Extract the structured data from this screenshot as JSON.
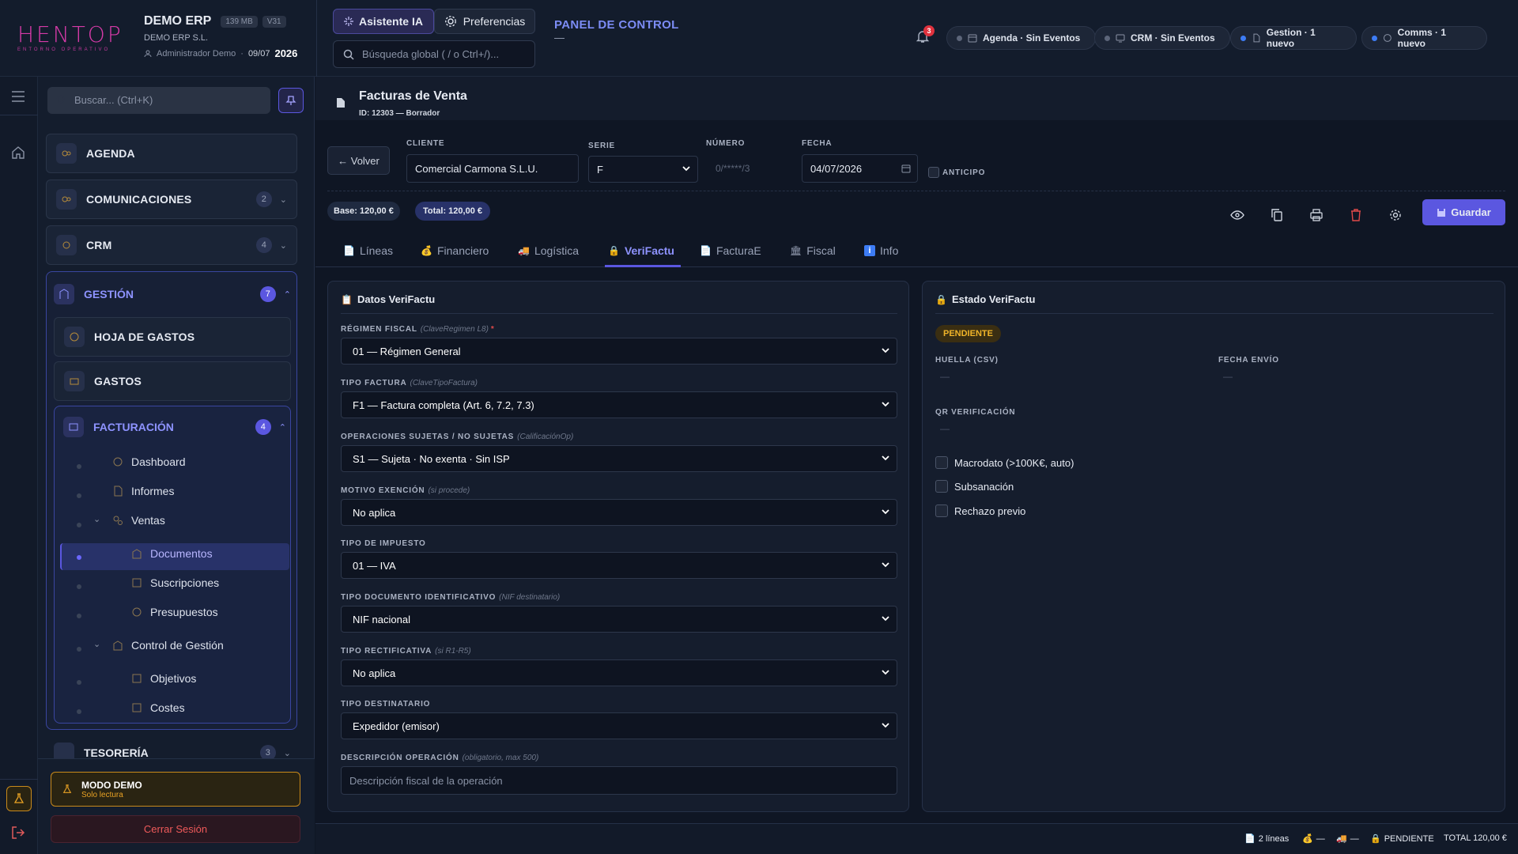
{
  "brand": {
    "logo_text": "HENTOP",
    "logo_sub": "ENTORNO OPERATIVO"
  },
  "company": {
    "name": "DEMO ERP",
    "size_badge": "139 MB",
    "version_badge": "V31",
    "legal": "DEMO ERP S.L.",
    "user": "Administrador Demo",
    "date": "09/07",
    "year": "2026"
  },
  "header": {
    "assistant": "Asistente IA",
    "prefs": "Preferencias",
    "search_placeholder": "Búsqueda global ( / o Ctrl+/)...",
    "panel_title": "PANEL DE CONTROL",
    "panel_sub": "—",
    "notif_count": "3",
    "pills": [
      "Agenda · Sin Eventos",
      "CRM · Sin Eventos",
      "Gestion · 1 nuevo",
      "Comms · 1 nuevo"
    ]
  },
  "sidebar": {
    "search_placeholder": "Buscar... (Ctrl+K)",
    "agenda": "AGENDA",
    "comunicaciones": "COMUNICACIONES",
    "comunicaciones_count": "2",
    "crm": "CRM",
    "crm_count": "4",
    "gestion": "GESTIÓN",
    "gestion_count": "7",
    "hoja_gastos": "HOJA DE GASTOS",
    "gastos": "GASTOS",
    "facturacion": "FACTURACIÓN",
    "facturacion_count": "4",
    "items": {
      "dashboard": "Dashboard",
      "informes": "Informes",
      "ventas": "Ventas",
      "documentos": "Documentos",
      "suscripciones": "Suscripciones",
      "presupuestos": "Presupuestos",
      "control": "Control de Gestión",
      "objetivos": "Objetivos",
      "costes": "Costes"
    },
    "tesoreria": "TESORERÍA",
    "tesoreria_count": "3",
    "demo_title": "MODO DEMO",
    "demo_sub": "Solo lectura",
    "logout": "Cerrar Sesión"
  },
  "doc": {
    "title": "Facturas de Venta",
    "id_line": "ID: 12303 — Borrador",
    "back": "← Volver",
    "cliente_label": "CLIENTE",
    "cliente": "Comercial Carmona S.L.U.",
    "serie_label": "SERIE",
    "serie": "F",
    "numero_label": "NÚMERO",
    "numero": "0/*****/3",
    "fecha_label": "FECHA",
    "fecha": "04/07/2026",
    "anticipo": "ANTICIPO",
    "base": "Base: 120,00 €",
    "total": "Total: 120,00 €",
    "save": "Guardar"
  },
  "tabs": [
    "Líneas",
    "Financiero",
    "Logística",
    "VeriFactu",
    "FacturaE",
    "Fiscal",
    "Info"
  ],
  "verifactu": {
    "title": "Datos VeriFactu",
    "fields": [
      {
        "label": "RÉGIMEN FISCAL",
        "hint": "(ClaveRegimen L8)",
        "req": "*",
        "value": "01 — Régimen General"
      },
      {
        "label": "TIPO FACTURA",
        "hint": "(ClaveTipoFactura)",
        "value": "F1 — Factura completa (Art. 6, 7.2, 7.3)"
      },
      {
        "label": "OPERACIONES SUJETAS / NO SUJETAS",
        "hint": "(CalificaciónOp)",
        "value": "S1 — Sujeta · No exenta · Sin ISP"
      },
      {
        "label": "MOTIVO EXENCIÓN",
        "hint": "(si procede)",
        "value": "No aplica"
      },
      {
        "label": "TIPO DE IMPUESTO",
        "hint": "",
        "value": "01 — IVA"
      },
      {
        "label": "TIPO DOCUMENTO IDENTIFICATIVO",
        "hint": "(NIF destinatario)",
        "value": "NIF nacional"
      },
      {
        "label": "TIPO RECTIFICATIVA",
        "hint": "(si R1-R5)",
        "value": "No aplica"
      },
      {
        "label": "TIPO DESTINATARIO",
        "hint": "",
        "value": "Expedidor (emisor)"
      }
    ],
    "desc_label": "DESCRIPCIÓN OPERACIÓN",
    "desc_hint": "(obligatorio, max 500)",
    "desc_placeholder": "Descripción fiscal de la operación"
  },
  "estado": {
    "title": "Estado VeriFactu",
    "status": "PENDIENTE",
    "huella_label": "HUELLA (CSV)",
    "huella": "—",
    "envio_label": "FECHA ENVÍO",
    "envio": "—",
    "qr_label": "QR VERIFICACIÓN",
    "qr": "—",
    "checks": [
      "Macrodato (>100K€, auto)",
      "Subsanación",
      "Rechazo previo"
    ]
  },
  "footer": {
    "lines": "2 líneas",
    "fin": "—",
    "log": "—",
    "status": "PENDIENTE",
    "total": "TOTAL 120,00 €"
  }
}
